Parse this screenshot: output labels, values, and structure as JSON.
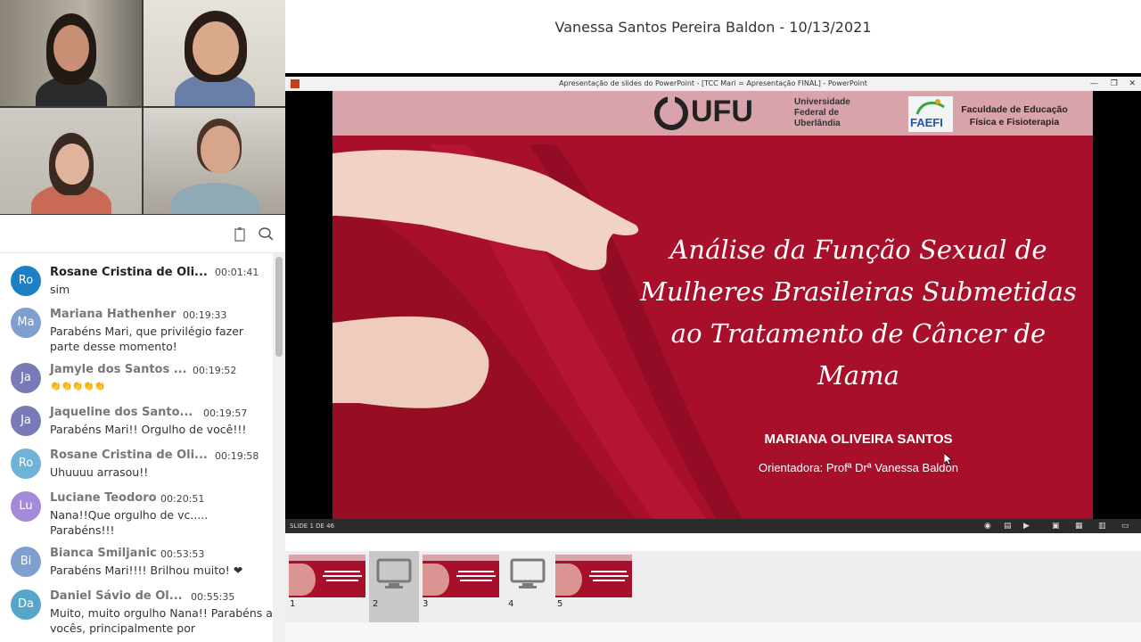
{
  "header": {
    "presenter_label": "Vanessa Santos Pereira Baldon - 10/13/2021"
  },
  "powerpoint": {
    "window_title": "Apresentação de slides do PowerPoint - [TCC Mari = Apresentação FINAL] - PowerPoint",
    "status": "SLIDE 1 DE 46",
    "slide": {
      "title": "Análise da Função Sexual de Mulheres Brasileiras Submetidas ao Tratamento de Câncer de Mama",
      "author": "MARIANA OLIVEIRA SANTOS",
      "advisor": "Orientadora: Profª Drª Vanessa Baldon",
      "logo_ufu": "UFU",
      "logo_ufu_sub": "Universidade Federal de Uberlândia",
      "logo_faefi": "FAEFI",
      "logo_faefi_sub": "Faculdade de Educação Física e Fisioterapia"
    }
  },
  "thumbnails": [
    {
      "num": "1",
      "kind": "slide"
    },
    {
      "num": "2",
      "kind": "screen"
    },
    {
      "num": "3",
      "kind": "slide"
    },
    {
      "num": "4",
      "kind": "screen"
    },
    {
      "num": "5",
      "kind": "slide"
    }
  ],
  "chat": {
    "messages": [
      {
        "initials": "Ro",
        "name": "Rosane Cristina de Oli...",
        "time": "00:01:41",
        "text": "sim",
        "color": "#1e7fc4"
      },
      {
        "initials": "Ma",
        "name": "Mariana Hathenher",
        "time": "00:19:33",
        "text": "Parabéns Mari, que privilégio fazer parte desse momento!",
        "color": "#7f9fcf"
      },
      {
        "initials": "Ja",
        "name": "Jamyle dos Santos ...",
        "time": "00:19:52",
        "text": "👏👏👏👏👏",
        "color": "#7a7ab8"
      },
      {
        "initials": "Ja",
        "name": "Jaqueline dos Santo...",
        "time": "00:19:57",
        "text": "Parabéns Mari!! Orgulho de você!!!",
        "color": "#7a7ab8"
      },
      {
        "initials": "Ro",
        "name": "Rosane Cristina de Oli...",
        "time": "00:19:58",
        "text": "Uhuuuu arrasou!!",
        "color": "#6fb3d9"
      },
      {
        "initials": "Lu",
        "name": "Luciane Teodoro",
        "time": "00:20:51",
        "text": "Nana!!Que orgulho de vc..... Parabéns!!!",
        "color": "#a58ad9"
      },
      {
        "initials": "Bi",
        "name": "Bianca Smiljanic",
        "time": "00:53:53",
        "text": "Parabéns Mari!!!! Brilhou muito! ❤",
        "color": "#7f9fcf"
      },
      {
        "initials": "Da",
        "name": "Daniel Sávio de Ol...",
        "time": "00:55:35",
        "text": "Muito, muito orgulho Nana!! Parabéns a vocês, principalmente por",
        "color": "#55a6c9"
      }
    ]
  }
}
